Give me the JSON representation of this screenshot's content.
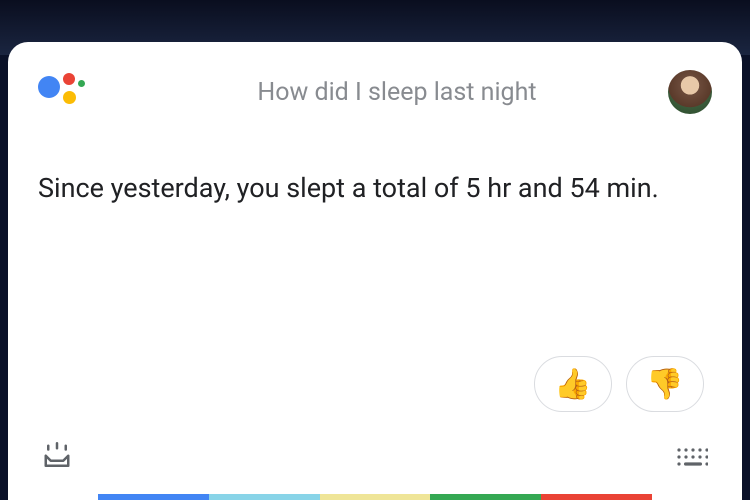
{
  "header": {
    "query": "How did I sleep last night"
  },
  "response": {
    "text": "Since yesterday, you slept a total of 5 hr and 54 min."
  },
  "feedback": {
    "thumbs_up": "👍",
    "thumbs_down": "👎"
  }
}
